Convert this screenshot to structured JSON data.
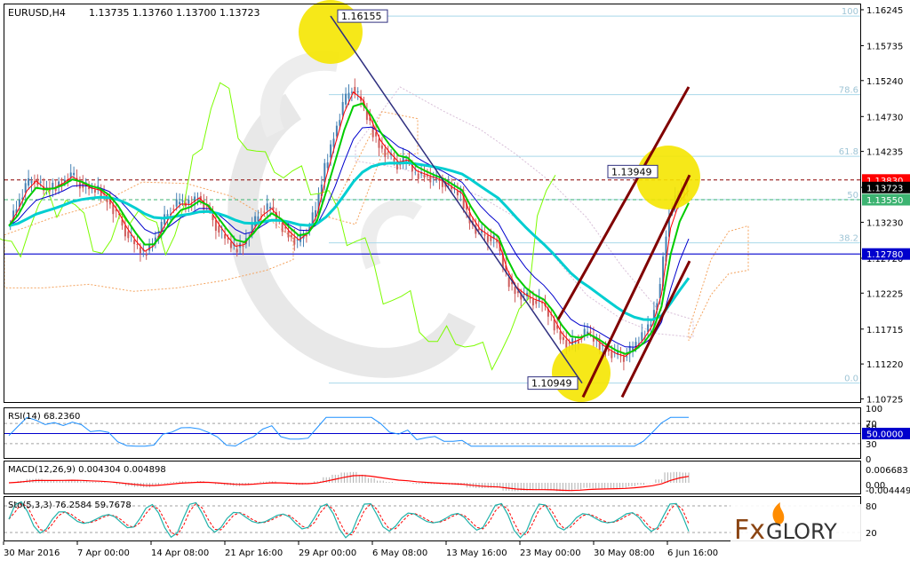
{
  "header": {
    "symbol": "EURUSD,H4",
    "ohlc": "1.13735 1.13760 1.13700 1.13723"
  },
  "chart_data": {
    "type": "candlestick",
    "symbol": "EURUSD",
    "timeframe": "H4",
    "price_axis": {
      "ticks": [
        "1.16245",
        "1.15735",
        "1.15240",
        "1.14730",
        "1.14235",
        "1.13725",
        "1.13230",
        "1.12720",
        "1.12225",
        "1.11715",
        "1.11220",
        "1.10725"
      ],
      "range": [
        1.10725,
        1.16245
      ]
    },
    "price_tags": [
      {
        "label": "1.13830",
        "price": 1.1383,
        "bg": "#ff0000"
      },
      {
        "label": "1.13723",
        "price": 1.13723,
        "bg": "#000000"
      },
      {
        "label": "1.13550",
        "price": 1.1355,
        "bg": "#3cb371"
      },
      {
        "label": "1.12780",
        "price": 1.1278,
        "bg": "#0000cd"
      }
    ],
    "fibonacci": {
      "high": 1.16155,
      "low": 1.10949,
      "levels": [
        {
          "label": "100",
          "price": 1.16155
        },
        {
          "label": "78.6",
          "price": 1.15041
        },
        {
          "label": "61.8",
          "price": 1.14166
        },
        {
          "label": "50",
          "price": 1.13552
        },
        {
          "label": "38.2",
          "price": 1.12938
        },
        {
          "label": "0.0",
          "price": 1.10949
        }
      ]
    },
    "annotations": [
      {
        "label": "1.16155",
        "price": 1.16155
      },
      {
        "label": "1.13949",
        "price": 1.13949
      },
      {
        "label": "1.10949",
        "price": 1.10949
      }
    ],
    "horizontal_lines": [
      {
        "price": 1.1383,
        "style": "dashed",
        "color": "#8b0000"
      },
      {
        "price": 1.1355,
        "style": "dashed",
        "color": "#3cb371"
      },
      {
        "price": 1.1278,
        "style": "solid",
        "color": "#0000cd"
      }
    ],
    "close_series": [
      1.1318,
      1.1345,
      1.1375,
      1.1385,
      1.1368,
      1.1372,
      1.138,
      1.139,
      1.1378,
      1.137,
      1.1368,
      1.1355,
      1.1335,
      1.131,
      1.1292,
      1.1278,
      1.1292,
      1.132,
      1.1342,
      1.1352,
      1.1348,
      1.136,
      1.1342,
      1.1318,
      1.13,
      1.1285,
      1.1292,
      1.1318,
      1.1338,
      1.1345,
      1.1322,
      1.1305,
      1.1295,
      1.131,
      1.134,
      1.14,
      1.1445,
      1.149,
      1.1515,
      1.1495,
      1.146,
      1.1432,
      1.1418,
      1.1405,
      1.1412,
      1.1392,
      1.139,
      1.1385,
      1.138,
      1.137,
      1.1362,
      1.1325,
      1.1308,
      1.1302,
      1.1295,
      1.1245,
      1.1225,
      1.1218,
      1.1212,
      1.1208,
      1.1185,
      1.116,
      1.1148,
      1.1158,
      1.1168,
      1.1152,
      1.1142,
      1.1135,
      1.1132,
      1.1145,
      1.116,
      1.1182,
      1.1232,
      1.1338,
      1.1362,
      1.1372
    ],
    "indicators": {
      "ichimoku": true,
      "moving_averages": [
        {
          "color": "#00ced1",
          "role": "slow"
        },
        {
          "color": "#00cc00",
          "role": "fast"
        },
        {
          "color": "#ff0000",
          "role": "tenkan"
        },
        {
          "color": "#0000cd",
          "role": "kijun"
        },
        {
          "color": "#7cfc00",
          "role": "chikou"
        }
      ]
    },
    "trend_channel": {
      "color": "#800000",
      "lines": 3,
      "direction": "up"
    },
    "time_axis": [
      "30 Mar 2016",
      "7 Apr 00:00",
      "14 Apr 08:00",
      "21 Apr 16:00",
      "29 Apr 00:00",
      "6 May 08:00",
      "13 May 16:00",
      "23 May 00:00",
      "30 May 08:00",
      "6 Jun 16:00"
    ],
    "rsi": {
      "label": "RSI(14) 68.2360",
      "ticks": [
        "100",
        "70",
        "50",
        "30",
        "0"
      ],
      "tag": "50.0000",
      "level": 50
    },
    "macd": {
      "label": "MACD(12,26,9) 0.004304 0.004898",
      "ticks": [
        "0.006683",
        "0.00",
        "-0.004449"
      ]
    },
    "stochastic": {
      "label": "Sto(5,3,3) 76.2584 59.7678",
      "ticks": [
        "80",
        "20"
      ]
    }
  },
  "logo": {
    "text_fx": "Fx",
    "text_glory": "GLORY",
    "color_fx": "#8b4513",
    "color_glory": "#333333",
    "color_flame": "#ff8c00"
  }
}
